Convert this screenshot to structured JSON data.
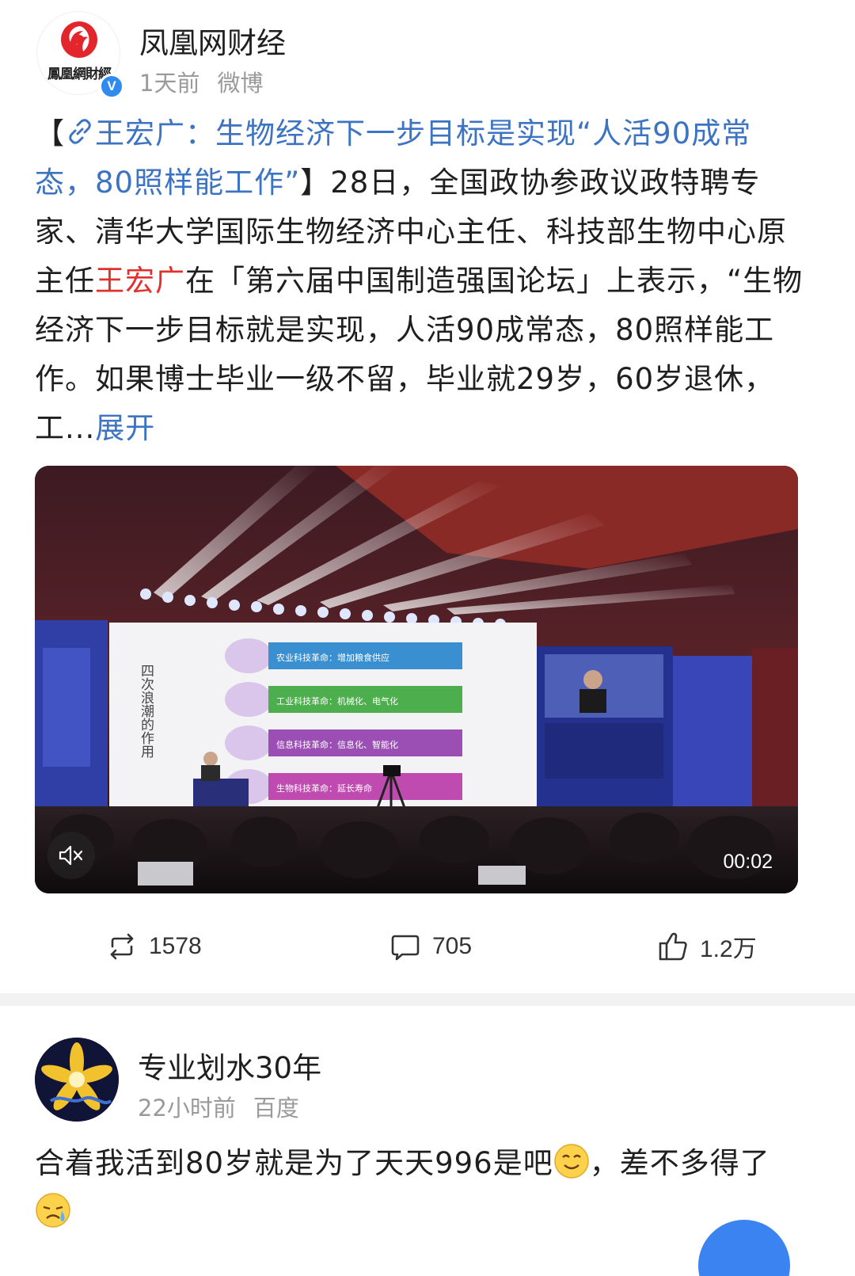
{
  "post": {
    "author": {
      "name": "凤凰网财经",
      "avatar_text": "鳳凰網財經",
      "verified_icon": "verified-badge-icon",
      "verified_glyph": "V"
    },
    "time": "1天前",
    "source": "微博",
    "body": {
      "bracket_open": "【",
      "topic_link_icon": "link-icon",
      "topic": "王宏广：生物经济下一步目标是实现“人活90成常态，80照样能工作”",
      "bracket_close": "】",
      "text_before_mention": "28日，全国政协参政议政特聘专家、清华大学国际生物经济中心主任、科技部生物中心原主任",
      "mention": "王宏广",
      "text_after_mention": "在「第六届中国制造强国论坛」上表示，“生物经济下一步目标就是实现，人活90成常态，80照样能工作。如果博士毕业一级不留，毕业就29岁，60岁退休，工...",
      "expand_label": "展开"
    },
    "video": {
      "duration": "00:02",
      "mute_icon": "muted-speaker-icon",
      "slide_title": "四次浪潮的作用",
      "slide_rows": [
        {
          "label": "农业科技革命：增加粮食供应",
          "color": "#3a8fd0"
        },
        {
          "label": "工业科技革命：机械化、电气化",
          "color": "#4cae4c"
        },
        {
          "label": "信息科技革命：信息化、智能化",
          "color": "#9b4fb5"
        },
        {
          "label": "生物科技革命：延长寿命",
          "color": "#c04bb0"
        }
      ]
    },
    "actions": {
      "repost": {
        "icon": "repost-icon",
        "count": "1578"
      },
      "comment": {
        "icon": "comment-icon",
        "count": "705"
      },
      "like": {
        "icon": "thumbs-up-icon",
        "count": "1.2万"
      }
    }
  },
  "comment": {
    "author": "专业划水30年",
    "time": "22小时前",
    "source": "百度",
    "text_part1": "合着我活到80岁就是为了天天996是吧",
    "emoji1": "smirk-emoji",
    "text_part2": "，差不多得了",
    "emoji2": "crying-emoji"
  },
  "colors": {
    "link_blue": "#3c73c2",
    "mention_red": "#e2312d",
    "meta_gray": "#9a9a9a",
    "badge_blue": "#2f8bf0"
  }
}
